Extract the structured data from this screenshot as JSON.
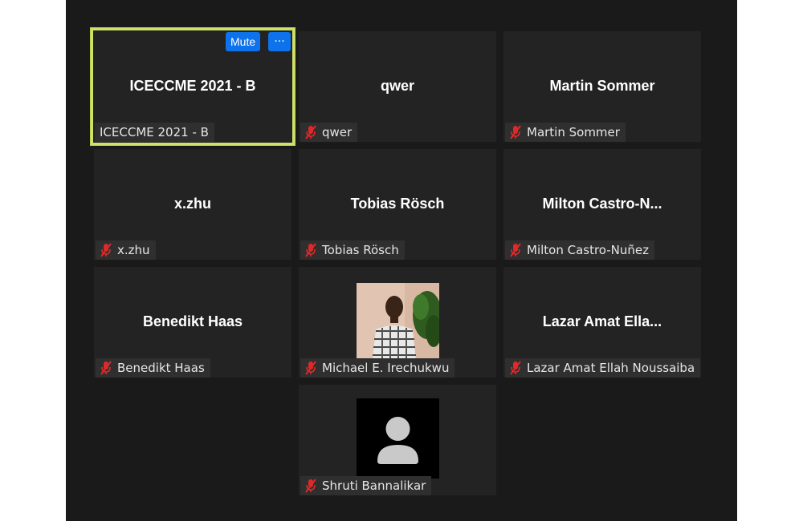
{
  "controls": {
    "mute_label": "Mute",
    "more_label": "···"
  },
  "colors": {
    "active_border": "#cfe06b",
    "button_blue": "#0e72ed",
    "muted_mic": "#e02828",
    "tile_bg": "#232323",
    "background": "#1a1a1a"
  },
  "participants": [
    {
      "display": "ICECCME 2021 - B",
      "tag": "ICECCME 2021 - B",
      "muted": false,
      "active": true,
      "video": "name"
    },
    {
      "display": "qwer",
      "tag": "qwer",
      "muted": true,
      "video": "name"
    },
    {
      "display": "Martin Sommer",
      "tag": "Martin Sommer",
      "muted": true,
      "video": "name"
    },
    {
      "display": "x.zhu",
      "tag": "x.zhu",
      "muted": true,
      "video": "name"
    },
    {
      "display": "Tobias Rösch",
      "tag": "Tobias Rösch",
      "muted": true,
      "video": "name"
    },
    {
      "display": "Milton  Castro-N...",
      "tag": "Milton Castro-Nuñez",
      "muted": true,
      "video": "name"
    },
    {
      "display": "Benedikt Haas",
      "tag": "Benedikt Haas",
      "muted": true,
      "video": "name"
    },
    {
      "display": "",
      "tag": "Michael E. Irechukwu",
      "muted": true,
      "video": "photo"
    },
    {
      "display": "Lazar  Amat  Ella...",
      "tag": "Lazar Amat Ellah Noussaiba",
      "muted": true,
      "video": "name"
    },
    {
      "display": "",
      "tag": "Shruti Bannalikar",
      "muted": true,
      "video": "avatar"
    }
  ]
}
